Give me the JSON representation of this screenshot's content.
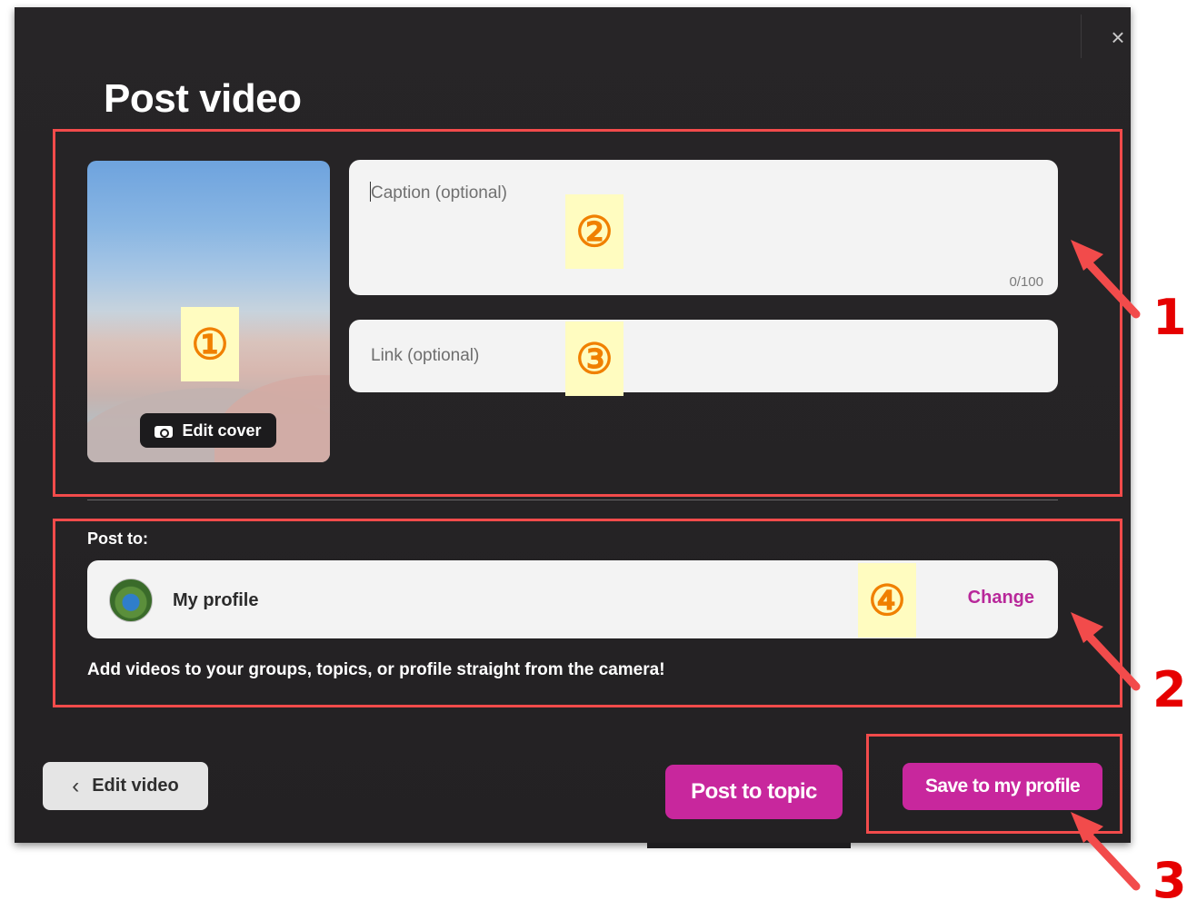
{
  "dialog": {
    "title": "Post video",
    "close_glyph": "×"
  },
  "cover": {
    "edit_label": "Edit cover",
    "icon": "camera-icon"
  },
  "caption": {
    "placeholder": "Caption (optional)",
    "counter": "0/100"
  },
  "link": {
    "placeholder": "Link (optional)"
  },
  "post_to": {
    "label": "Post to:",
    "target_name": "My profile",
    "change_label": "Change",
    "helper": "Add videos to your groups, topics, or profile straight from the camera!"
  },
  "footer": {
    "back_label": "Edit video",
    "back_icon": "chevron-left-icon",
    "chevron_glyph": "‹",
    "post_topic_label": "Post to topic",
    "save_label": "Save to my profile"
  },
  "annotations": {
    "markers": [
      "①",
      "②",
      "③",
      "④"
    ],
    "callouts": [
      "1",
      "2",
      "3"
    ],
    "color": "#e60000",
    "marker_bg": "#fffcc0",
    "marker_color": "#f08000"
  },
  "colors": {
    "accent": "#c8279d",
    "dialog_bg": "#252325",
    "field_bg": "#f3f3f3"
  }
}
